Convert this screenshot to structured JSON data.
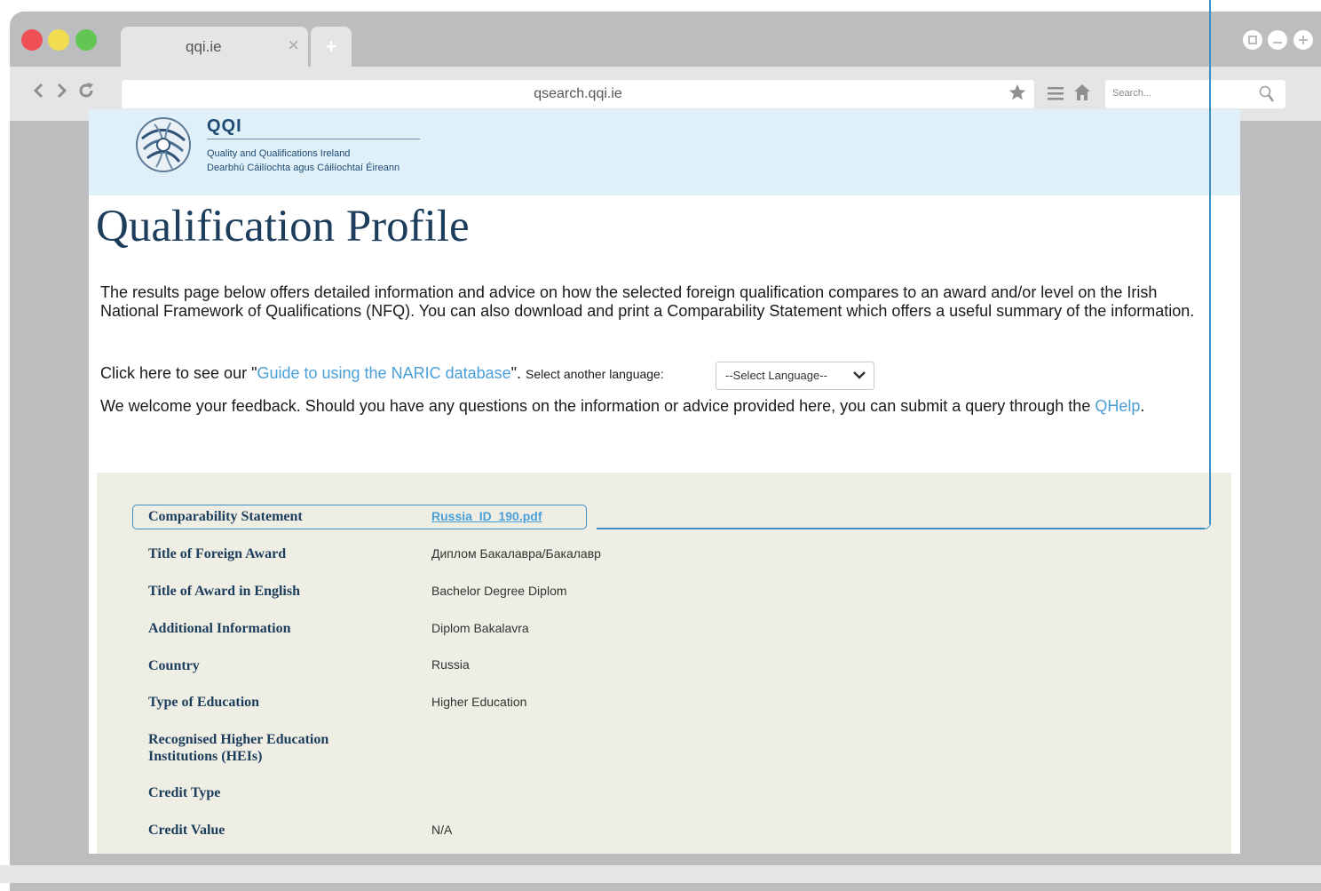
{
  "browser": {
    "tab_title": "qqi.ie",
    "tab_close": "×",
    "new_tab": "+",
    "url": "qsearch.qqi.ie",
    "search_placeholder": "Search..."
  },
  "logo": {
    "name": "QQI",
    "line1": "Quality and Qualifications Ireland",
    "line2": "Dearbhú Cáilíochta agus Cáilíochtaí Éireann"
  },
  "page": {
    "title": "Qualification Profile",
    "intro": "The results page below offers detailed information and advice on how the selected foreign qualification compares to an award and/or level on the Irish National Framework of Qualifications (NFQ). You can also download and print a Comparability Statement which offers a useful summary of the information.",
    "guide_prefix": "Click here to see our \"",
    "guide_link": "Guide to using the NARIC database",
    "guide_suffix": "\".",
    "lang_label": "Select another language:",
    "lang_value": "--Select Language--",
    "feedback_text": "We welcome your feedback. Should you have any questions on the information or advice provided here, you can submit a query through the",
    "feedback_link": "QHelp",
    "feedback_end": "."
  },
  "profile": {
    "comparability_label": "Comparability Statement",
    "comparability_value": "Russia_ID_190.pdf",
    "foreign_title_label": "Title of Foreign Award",
    "foreign_title_value": "Диплом Бакалавра/Бакалавр",
    "english_title_label": "Title of Award in English",
    "english_title_value": "Bachelor Degree Diplom",
    "additional_label": "Additional Information",
    "additional_value": "Diplom Bakalavra",
    "country_label": "Country",
    "country_value": "Russia",
    "education_type_label": "Type of Education",
    "education_type_value": "Higher Education",
    "hei_label": "Recognised Higher Education Institutions (HEIs)",
    "credit_type_label": "Credit Type",
    "credit_value_label": "Credit Value",
    "credit_value_value": "N/A"
  },
  "colors": {
    "banner": "#dff0f8",
    "panel": "#eeeee5",
    "link": "#4a9fd8",
    "heading": "#1c3d5c",
    "callout": "#3b8ec4"
  }
}
